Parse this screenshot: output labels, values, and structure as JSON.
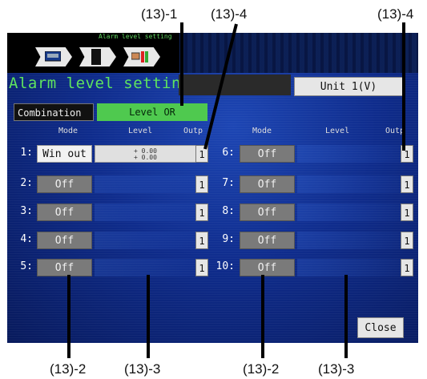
{
  "callouts": {
    "c_top_1": "(13)-1",
    "c_top_4a": "(13)-4",
    "c_top_4b": "(13)-4",
    "c_bot_2a": "(13)-2",
    "c_bot_3a": "(13)-3",
    "c_bot_2b": "(13)-2",
    "c_bot_3b": "(13)-3"
  },
  "screen": {
    "breadcrumb_title": "Alarm level setting",
    "page_title": "Alarm level settings",
    "unit_button": "Unit  1(V)",
    "combination_label": "Combination",
    "combination_value": "Level OR",
    "headers": {
      "mode": "Mode",
      "level": "Level",
      "output": "Outp"
    },
    "rows": [
      {
        "num": "1:",
        "mode": "Win out",
        "level_hi": "+ 0.00",
        "level_lo": "+ 0.00",
        "out": "1"
      },
      {
        "num": "2:",
        "mode": "Off",
        "out": "1"
      },
      {
        "num": "3:",
        "mode": "Off",
        "out": "1"
      },
      {
        "num": "4:",
        "mode": "Off",
        "out": "1"
      },
      {
        "num": "5:",
        "mode": "Off",
        "out": "1"
      },
      {
        "num": "6:",
        "mode": "Off",
        "out": "1"
      },
      {
        "num": "7:",
        "mode": "Off",
        "out": "1"
      },
      {
        "num": "8:",
        "mode": "Off",
        "out": "1"
      },
      {
        "num": "9:",
        "mode": "Off",
        "out": "1"
      },
      {
        "num": "10:",
        "mode": "Off",
        "out": "1"
      }
    ],
    "close_button": "Close"
  },
  "icons": [
    "monitor-icon",
    "memory-card-icon",
    "printer-icon"
  ],
  "colors": {
    "title_green": "#5fe35f",
    "combo_green": "#4fc94f",
    "screen_blue": "#0f2c8c"
  }
}
